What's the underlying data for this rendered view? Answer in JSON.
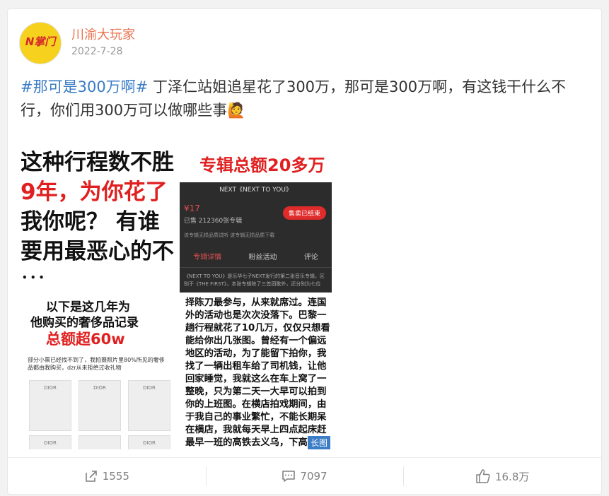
{
  "post": {
    "username": "川渝大玩家",
    "date": "2022-7-28",
    "hashtag": "#那可是300万啊#",
    "text": " 丁泽仁站姐追星花了300万，那可是300万啊，有这钱干什么不行，你们用300万可以做哪些事",
    "emoji": "🙋"
  },
  "avatar": {
    "logo_text": "N掌门"
  },
  "images": {
    "img1": {
      "line1": "这种行程数不胜",
      "line2": "9年，为你花了",
      "line3": "我你呢？ 有谁",
      "line4": "要用最恶心的不",
      "dots": "• • •"
    },
    "img2": {
      "top_text": "专辑总额20多万",
      "phone_title": "NEXT《NEXT TO YOU》",
      "price": "¥17",
      "count": "已售 212360张专辑",
      "sold_button": "售卖已结束",
      "options": "该专辑无损品质试听     该专辑无损品质下载",
      "tab1": "专辑详情",
      "tab2": "粉丝活动",
      "tab3": "评论",
      "desc": "《NEXT TO YOU》是乐华七子NEXT发行的第二张音乐专辑，区别于《THE FIRST》，本张专辑除了三首团歌外，还分别为七位"
    },
    "img3": {
      "head1": "以下是这几年为",
      "head2": "他购买的奢侈品记录",
      "total": "总额超60w",
      "note": "部分小票已经找不到了，我拍摄照片里80%所见的奢侈品都由我购买，dzr从未拒绝过收礼物",
      "brand": "DIOR"
    },
    "img4": {
      "text": "择陈刀最参与，从来就席过。连国外的活动也是次次没落下。巴黎一趟行程就花了10几万，仅仅只想看能给你出几张图。曾经有一个偏远地区的活动，为了能留下拍你，我找了一辆出租车给了司机钱，让他回家睡觉，我就这么在车上窝了一整晚，只为第二天一大早可以拍到你的上班图。在横店拍戏期间，由于我自己的事业繁忙，不能长期呆在横店，我就每天早上四点起床赶最早一班的高铁去义乌，下高铁后再打车到横店，只为给你拍一个十几秒的上班图，拍完后再匆忙赶回海，类似这种行程数不胜数",
      "badge": "长图"
    }
  },
  "footer": {
    "share_count": "1555",
    "comment_count": "7097",
    "like_count": "16.8万"
  },
  "colors": {
    "username": "#eb7350",
    "hashtag": "#3a7cc6",
    "accent_red": "#e02020"
  }
}
